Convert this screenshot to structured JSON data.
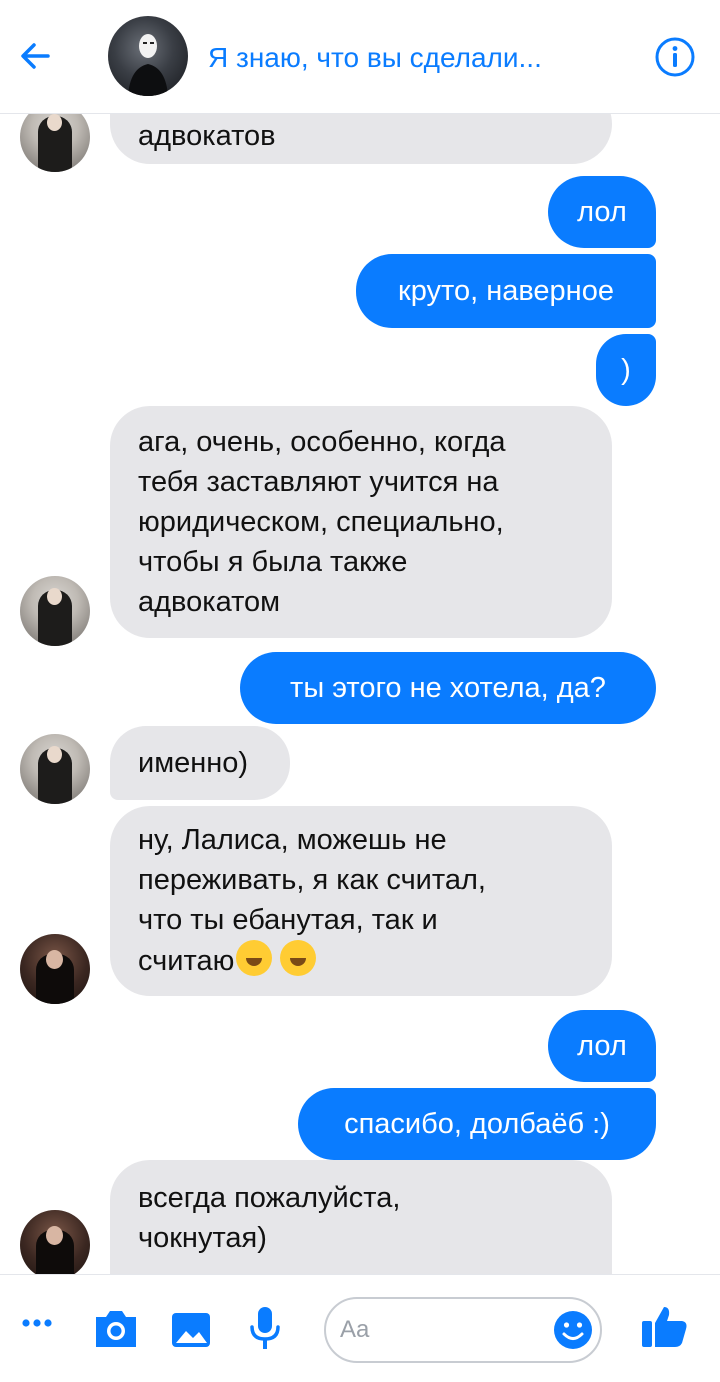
{
  "header": {
    "title": "Я знаю, что вы сделали..."
  },
  "messages": [
    {
      "dir": "in",
      "text": "адвокатов"
    },
    {
      "dir": "out",
      "text": "лол"
    },
    {
      "dir": "out",
      "text": "круто, наверное"
    },
    {
      "dir": "out",
      "text": ")"
    },
    {
      "dir": "in",
      "lines": [
        "ага, очень, особенно, когда",
        "тебя заставляют учится на",
        "юридическом, специально,",
        "чтобы я была также",
        "адвокатом"
      ]
    },
    {
      "dir": "out",
      "text": "ты этого не хотела, да?"
    },
    {
      "dir": "in",
      "text": "именно)"
    },
    {
      "dir": "in",
      "lines": [
        "ну, Лалиса, можешь не",
        "переживать, я как считал,",
        "что ты ебанутая, так и",
        "считаю"
      ]
    },
    {
      "dir": "out",
      "text": "лол"
    },
    {
      "dir": "out",
      "text": "спасибо, долбаёб :)"
    },
    {
      "dir": "in",
      "lines": [
        "всегда пожалуйста,",
        "чокнутая)"
      ]
    }
  ],
  "composer": {
    "placeholder": "Aa"
  },
  "colors": {
    "accent": "#0a7cff",
    "incoming_bubble": "#e6e6e9"
  },
  "icons": [
    "back-arrow-icon",
    "info-icon",
    "more-icon",
    "camera-icon",
    "image-icon",
    "microphone-icon",
    "emoji-icon",
    "like-icon"
  ]
}
